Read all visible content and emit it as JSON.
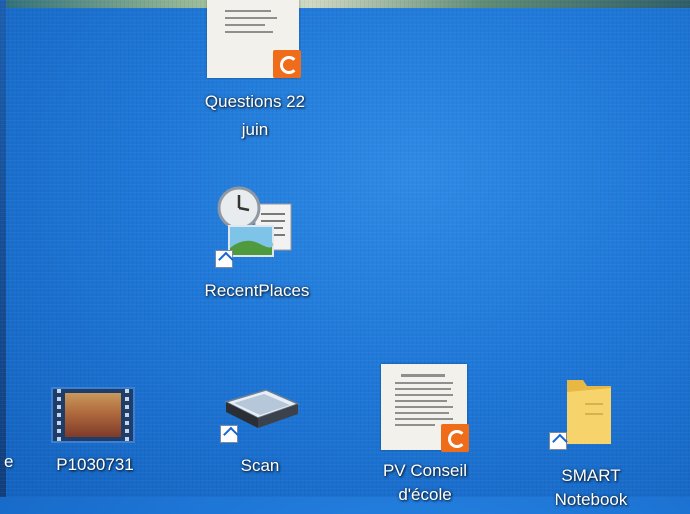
{
  "desktop": {
    "icons": [
      {
        "label": "Questions 22",
        "label_line2": "juin",
        "icon": "pdf-document-icon"
      },
      {
        "label": "RecentPlaces",
        "icon": "recent-places-icon"
      },
      {
        "label": "P1030731",
        "icon": "video-file-icon"
      },
      {
        "label": "Scan",
        "icon": "scanner-icon"
      },
      {
        "label": "PV Conseil",
        "label_line2": "d'école",
        "icon": "pdf-document-icon"
      },
      {
        "label": "SMART",
        "label_line2": "Notebook",
        "icon": "folder-icon"
      }
    ],
    "left_cut_label": "e"
  },
  "colors": {
    "wallpaper": "#1f78d8",
    "pdf_badge": "#ef6c1a",
    "folder": "#f6d46b"
  }
}
